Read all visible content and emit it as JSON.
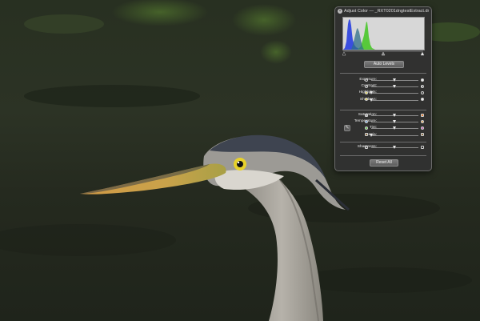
{
  "window": {
    "title": "Adjust Color — _RXT0201dngtestExtract.dng",
    "close_icon": "close-icon"
  },
  "histogram": {
    "colors": {
      "blue": "#3a4ee0",
      "green": "#57c93b",
      "background": "#d7d7d7"
    },
    "black_point": 0.0,
    "midpoint": 0.5,
    "white_point": 1.0
  },
  "buttons": {
    "auto_levels": "Auto Levels",
    "reset_all": "Reset All"
  },
  "groups": {
    "tone": [
      {
        "id": "exposure",
        "label": "Exposure:",
        "value": 0.5,
        "left_icon": "exposure-low-icon",
        "right_icon": "exposure-high-icon"
      },
      {
        "id": "contrast",
        "label": "Contrast:",
        "value": 0.5,
        "left_icon": "contrast-low-icon",
        "right_icon": "contrast-high-icon"
      },
      {
        "id": "highlights",
        "label": "Highlights:",
        "value": 0.0,
        "left_icon": "highlights-low-icon",
        "right_icon": "highlights-high-icon"
      },
      {
        "id": "shadows",
        "label": "Shadows:",
        "value": 0.0,
        "left_icon": "shadows-low-icon",
        "right_icon": "shadows-high-icon"
      }
    ],
    "color": [
      {
        "id": "saturation",
        "label": "Saturation:",
        "value": 0.5,
        "left_icon": "desaturated-icon",
        "right_icon": "saturated-icon"
      },
      {
        "id": "temperature",
        "label": "Temperature:",
        "value": 0.5,
        "left_icon": "cool-icon",
        "right_icon": "warm-icon"
      },
      {
        "id": "tint",
        "label": "Tint:",
        "value": 0.5,
        "left_icon": "green-tint-icon",
        "right_icon": "magenta-tint-icon"
      },
      {
        "id": "sepia",
        "label": "Sepia:",
        "value": 0.0,
        "left_icon": "sepia-low-icon",
        "right_icon": "sepia-high-icon"
      }
    ],
    "detail": [
      {
        "id": "sharpness",
        "label": "Sharpness:",
        "value": 0.5,
        "left_icon": "soft-icon",
        "right_icon": "sharp-icon"
      }
    ]
  },
  "eyedropper_icon": "eyedropper-icon"
}
